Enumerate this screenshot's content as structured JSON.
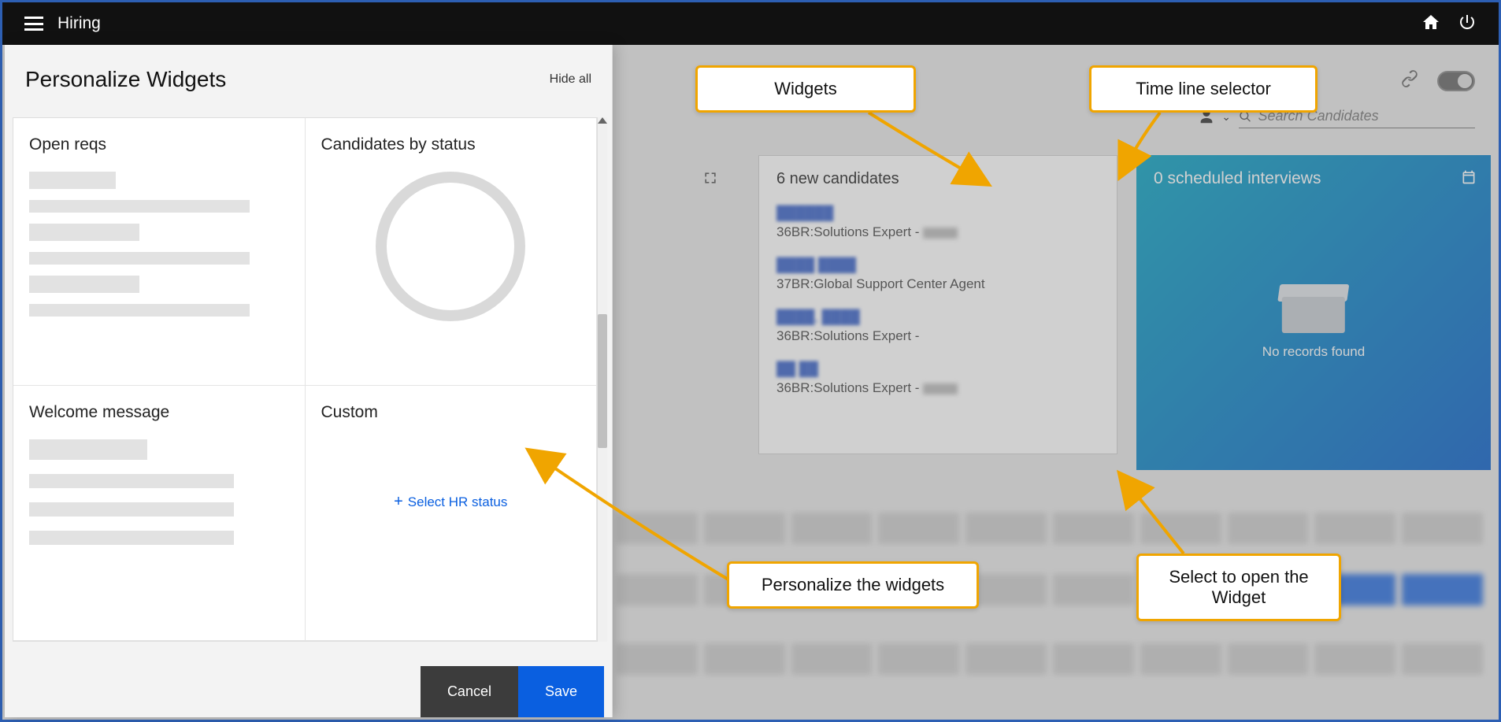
{
  "topbar": {
    "title": "Hiring"
  },
  "search": {
    "placeholder": "Search Candidates"
  },
  "modal": {
    "title": "Personalize Widgets",
    "hide_all": "Hide all",
    "cells": {
      "open_reqs": "Open reqs",
      "by_status": "Candidates by status",
      "welcome": "Welcome message",
      "custom": "Custom",
      "select_hr": "Select HR status"
    },
    "buttons": {
      "cancel": "Cancel",
      "save": "Save"
    }
  },
  "dashboard": {
    "new_candidates": {
      "title": "6 new candidates",
      "items": [
        {
          "sub": "36BR:Solutions Expert -"
        },
        {
          "sub": "37BR:Global Support Center Agent"
        },
        {
          "sub": "36BR:Solutions Expert -"
        },
        {
          "sub": "36BR:Solutions Expert -"
        }
      ]
    },
    "scheduled": {
      "title": "0 scheduled interviews",
      "empty": "No records found"
    }
  },
  "callouts": {
    "widgets": "Widgets",
    "timeline": "Time line selector",
    "personalize": "Personalize the widgets",
    "open": "Select to open the Widget"
  }
}
